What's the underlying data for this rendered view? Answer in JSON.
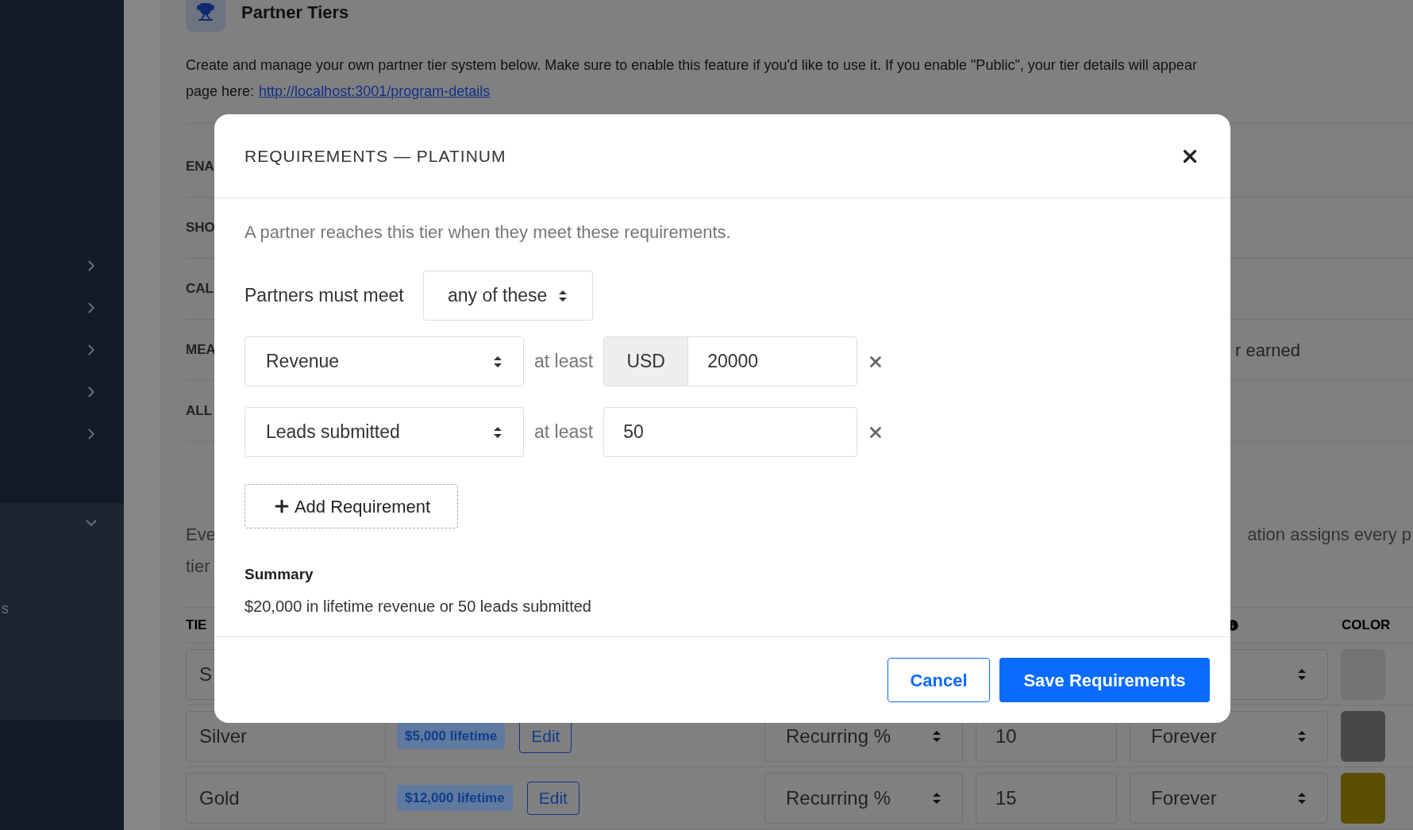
{
  "sidebar": {
    "items": [
      {
        "expanded": false
      },
      {
        "expanded": false
      },
      {
        "expanded": false
      },
      {
        "expanded": false
      },
      {
        "expanded": false
      },
      {
        "expanded": true,
        "children": [
          {
            "label": "s"
          }
        ]
      }
    ]
  },
  "page": {
    "title": "Partner Tiers",
    "description": "Create and manage your own partner tier system below. Make sure to enable this feature if you'd like to use it. If you enable \"Public\", your tier details will appear",
    "description_line_2": "page here:",
    "link": "http://localhost:3001/program-details",
    "settings": [
      {
        "label": "ENA"
      },
      {
        "label": "SHO"
      },
      {
        "label": "CAL"
      },
      {
        "label": "MEA",
        "value": "r earned"
      },
      {
        "label": "ALL"
      }
    ],
    "paragraph": {
      "line_1_start": "Eve",
      "line_1_end": "ation assigns every p",
      "line_2": "tier"
    },
    "table": {
      "columns": [
        "TIE",
        "COLOR"
      ],
      "rows": [
        {
          "name": "S",
          "color": "#737373"
        },
        {
          "name": "Silver",
          "requirement": "$5,000 lifetime",
          "edit": "Edit",
          "type": "Recurring %",
          "rate": "10",
          "duration": "Forever",
          "color": "#484848"
        },
        {
          "name": "Gold",
          "requirement": "$12,000 lifetime",
          "edit": "Edit",
          "type": "Recurring %",
          "rate": "15",
          "duration": "Forever",
          "color": "#5a4e00"
        }
      ]
    }
  },
  "modal": {
    "title": "REQUIREMENTS — PLATINUM",
    "intro": "A partner reaches this tier when they meet these requirements.",
    "match_label": "Partners must meet",
    "match_value": "any of these",
    "requirements": [
      {
        "metric": "Revenue",
        "comparator": "at least",
        "currency": "USD",
        "value": "20000"
      },
      {
        "metric": "Leads submitted",
        "comparator": "at least",
        "value": "50"
      }
    ],
    "add_button": "Add Requirement",
    "summary_title": "Summary",
    "summary": "$20,000 in lifetime revenue or 50 leads submitted",
    "cancel": "Cancel",
    "save": "Save Requirements"
  }
}
